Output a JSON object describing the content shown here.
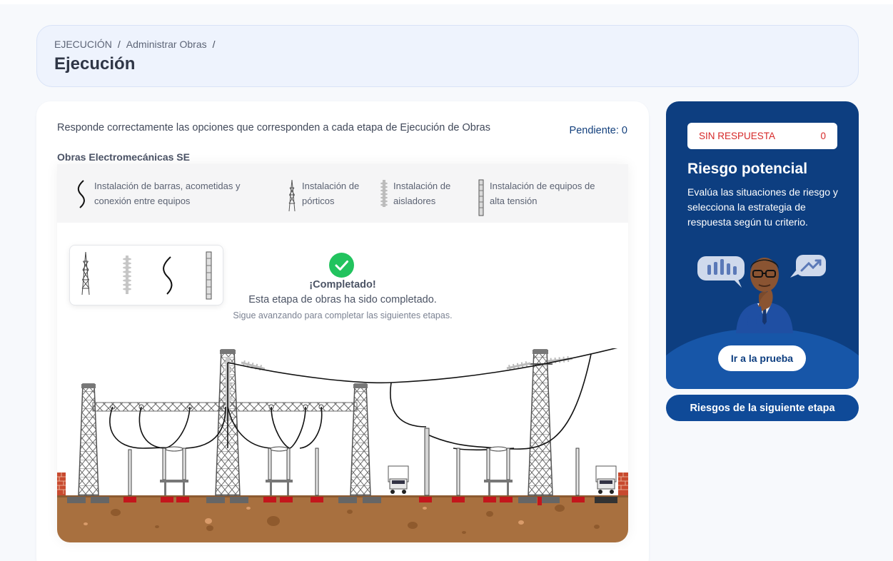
{
  "breadcrumb": {
    "items": [
      "EJECUCIÓN",
      "Administrar Obras"
    ],
    "separator": "/"
  },
  "page": {
    "title": "Ejecución"
  },
  "task": {
    "instruction": "Responde correctamente las opciones que corresponden a cada etapa de Ejecución de Obras",
    "pending_label": "Pendiente:",
    "pending_count": "0",
    "section_title": "Obras Electromecánicas SE"
  },
  "legend": {
    "items": [
      {
        "icon": "cable-icon",
        "line1": "Instalación de barras, acometidas y",
        "line2": "conexión entre equipos"
      },
      {
        "icon": "portico-tower-icon",
        "line1": "Instalación de",
        "line2": "pórticos"
      },
      {
        "icon": "insulator-icon",
        "line1": "Instalación de",
        "line2": "aisladores"
      },
      {
        "icon": "high-voltage-equipment-icon",
        "line1": "Instalación de equipos de",
        "line2": "alta tensión"
      }
    ]
  },
  "completion": {
    "title": "¡Completado!",
    "message": "Esta etapa de obras ha sido completado.",
    "hint": "Sigue avanzando para completar las siguientes etapas."
  },
  "risk_panel": {
    "status_label": "SIN RESPUESTA",
    "status_count": "0",
    "title": "Riesgo potencial",
    "description": "Evalúa las situaciones de riesgo y selecciona la estrategia de respuesta según tu criterio.",
    "button_label": "Ir a la prueba"
  },
  "next_button_label": "Riesgos de la siguiente etapa",
  "colors": {
    "panel_blue": "#0d3e80",
    "button_blue": "#0f4a98",
    "success_green": "#22c35e",
    "status_red": "#d62828",
    "ground_brown": "#a8703f"
  }
}
